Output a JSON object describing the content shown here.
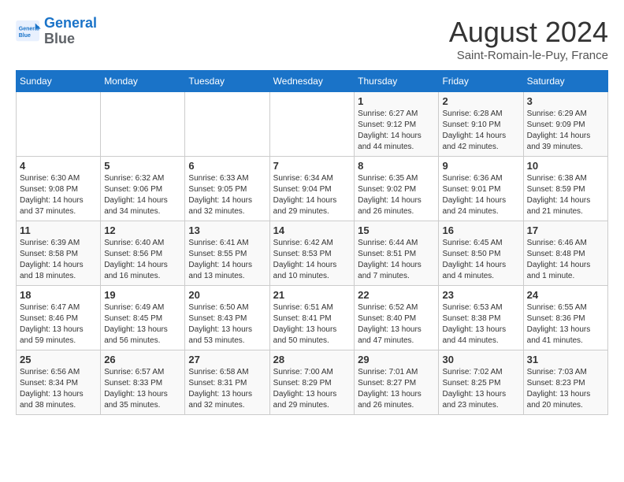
{
  "header": {
    "logo_line1": "General",
    "logo_line2": "Blue",
    "month_year": "August 2024",
    "location": "Saint-Romain-le-Puy, France"
  },
  "days_of_week": [
    "Sunday",
    "Monday",
    "Tuesday",
    "Wednesday",
    "Thursday",
    "Friday",
    "Saturday"
  ],
  "weeks": [
    [
      {
        "day": "",
        "info": ""
      },
      {
        "day": "",
        "info": ""
      },
      {
        "day": "",
        "info": ""
      },
      {
        "day": "",
        "info": ""
      },
      {
        "day": "1",
        "info": "Sunrise: 6:27 AM\nSunset: 9:12 PM\nDaylight: 14 hours and 44 minutes."
      },
      {
        "day": "2",
        "info": "Sunrise: 6:28 AM\nSunset: 9:10 PM\nDaylight: 14 hours and 42 minutes."
      },
      {
        "day": "3",
        "info": "Sunrise: 6:29 AM\nSunset: 9:09 PM\nDaylight: 14 hours and 39 minutes."
      }
    ],
    [
      {
        "day": "4",
        "info": "Sunrise: 6:30 AM\nSunset: 9:08 PM\nDaylight: 14 hours and 37 minutes."
      },
      {
        "day": "5",
        "info": "Sunrise: 6:32 AM\nSunset: 9:06 PM\nDaylight: 14 hours and 34 minutes."
      },
      {
        "day": "6",
        "info": "Sunrise: 6:33 AM\nSunset: 9:05 PM\nDaylight: 14 hours and 32 minutes."
      },
      {
        "day": "7",
        "info": "Sunrise: 6:34 AM\nSunset: 9:04 PM\nDaylight: 14 hours and 29 minutes."
      },
      {
        "day": "8",
        "info": "Sunrise: 6:35 AM\nSunset: 9:02 PM\nDaylight: 14 hours and 26 minutes."
      },
      {
        "day": "9",
        "info": "Sunrise: 6:36 AM\nSunset: 9:01 PM\nDaylight: 14 hours and 24 minutes."
      },
      {
        "day": "10",
        "info": "Sunrise: 6:38 AM\nSunset: 8:59 PM\nDaylight: 14 hours and 21 minutes."
      }
    ],
    [
      {
        "day": "11",
        "info": "Sunrise: 6:39 AM\nSunset: 8:58 PM\nDaylight: 14 hours and 18 minutes."
      },
      {
        "day": "12",
        "info": "Sunrise: 6:40 AM\nSunset: 8:56 PM\nDaylight: 14 hours and 16 minutes."
      },
      {
        "day": "13",
        "info": "Sunrise: 6:41 AM\nSunset: 8:55 PM\nDaylight: 14 hours and 13 minutes."
      },
      {
        "day": "14",
        "info": "Sunrise: 6:42 AM\nSunset: 8:53 PM\nDaylight: 14 hours and 10 minutes."
      },
      {
        "day": "15",
        "info": "Sunrise: 6:44 AM\nSunset: 8:51 PM\nDaylight: 14 hours and 7 minutes."
      },
      {
        "day": "16",
        "info": "Sunrise: 6:45 AM\nSunset: 8:50 PM\nDaylight: 14 hours and 4 minutes."
      },
      {
        "day": "17",
        "info": "Sunrise: 6:46 AM\nSunset: 8:48 PM\nDaylight: 14 hours and 1 minute."
      }
    ],
    [
      {
        "day": "18",
        "info": "Sunrise: 6:47 AM\nSunset: 8:46 PM\nDaylight: 13 hours and 59 minutes."
      },
      {
        "day": "19",
        "info": "Sunrise: 6:49 AM\nSunset: 8:45 PM\nDaylight: 13 hours and 56 minutes."
      },
      {
        "day": "20",
        "info": "Sunrise: 6:50 AM\nSunset: 8:43 PM\nDaylight: 13 hours and 53 minutes."
      },
      {
        "day": "21",
        "info": "Sunrise: 6:51 AM\nSunset: 8:41 PM\nDaylight: 13 hours and 50 minutes."
      },
      {
        "day": "22",
        "info": "Sunrise: 6:52 AM\nSunset: 8:40 PM\nDaylight: 13 hours and 47 minutes."
      },
      {
        "day": "23",
        "info": "Sunrise: 6:53 AM\nSunset: 8:38 PM\nDaylight: 13 hours and 44 minutes."
      },
      {
        "day": "24",
        "info": "Sunrise: 6:55 AM\nSunset: 8:36 PM\nDaylight: 13 hours and 41 minutes."
      }
    ],
    [
      {
        "day": "25",
        "info": "Sunrise: 6:56 AM\nSunset: 8:34 PM\nDaylight: 13 hours and 38 minutes."
      },
      {
        "day": "26",
        "info": "Sunrise: 6:57 AM\nSunset: 8:33 PM\nDaylight: 13 hours and 35 minutes."
      },
      {
        "day": "27",
        "info": "Sunrise: 6:58 AM\nSunset: 8:31 PM\nDaylight: 13 hours and 32 minutes."
      },
      {
        "day": "28",
        "info": "Sunrise: 7:00 AM\nSunset: 8:29 PM\nDaylight: 13 hours and 29 minutes."
      },
      {
        "day": "29",
        "info": "Sunrise: 7:01 AM\nSunset: 8:27 PM\nDaylight: 13 hours and 26 minutes."
      },
      {
        "day": "30",
        "info": "Sunrise: 7:02 AM\nSunset: 8:25 PM\nDaylight: 13 hours and 23 minutes."
      },
      {
        "day": "31",
        "info": "Sunrise: 7:03 AM\nSunset: 8:23 PM\nDaylight: 13 hours and 20 minutes."
      }
    ]
  ]
}
